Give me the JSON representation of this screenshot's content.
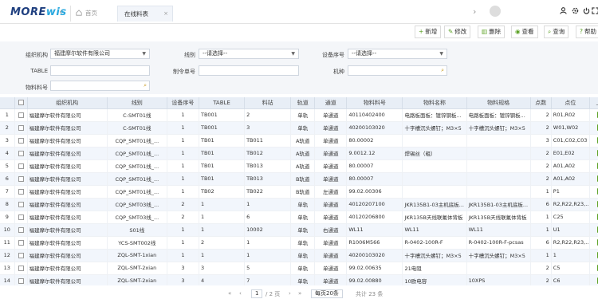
{
  "brand": {
    "logo_left": "MORE",
    "logo_right": "wis"
  },
  "tabs": {
    "home": "首页",
    "active": "在线料表",
    "close": "×"
  },
  "nav": {
    "back": "‹",
    "forward": "›"
  },
  "toolbar": {
    "add": "新增",
    "edit": "修改",
    "delete": "删除",
    "view": "查看",
    "query": "查询",
    "help": "帮助"
  },
  "filters": {
    "org_label": "组织机构",
    "org_value": "福建摩尔软件有限公司",
    "line_label": "线别",
    "line_value": "--请选择--",
    "device_label": "设备序号",
    "device_value": "--请选择--",
    "table_label": "TABLE",
    "table_value": "",
    "order_label": "制令单号",
    "order_value": "",
    "model_label": "机种",
    "model_value": "",
    "material_label": "物料料号",
    "material_value": ""
  },
  "columns": [
    "",
    "组织机构",
    "线别",
    "设备序号",
    "TABLE",
    "料站",
    "轨道",
    "通道",
    "物料料号",
    "物料名称",
    "物料规格",
    "点数",
    "点位",
    "上料"
  ],
  "rows": [
    [
      "1",
      "福建摩尔软件有限公司",
      "C-SMT01线",
      "1",
      "TB001",
      "2",
      "单轨",
      "单通道",
      "40110402400",
      "电路板面板：镀锌钢板...",
      "电路板面板：镀锌钢板...",
      "2",
      "R01,R02"
    ],
    [
      "2",
      "福建摩尔软件有限公司",
      "C-SMT01线",
      "1",
      "TB001",
      "3",
      "单轨",
      "单通道",
      "40200103020",
      "十字槽沉头螺钉；M3×5",
      "十字槽沉头螺钉；M3×5",
      "2",
      "W01,W02"
    ],
    [
      "3",
      "福建摩尔软件有限公司",
      "CQP_SMT01线_...",
      "1",
      "TB01",
      "TB011",
      "A轨道",
      "单通道",
      "80.00002",
      "",
      "",
      "3",
      "C01,C02,C03"
    ],
    [
      "4",
      "福建摩尔软件有限公司",
      "CQP_SMT01线_...",
      "1",
      "TB01",
      "TB012",
      "A轨道",
      "单通道",
      "9.0012.12",
      "焊锡丝（粗）",
      "",
      "2",
      "E01,E02"
    ],
    [
      "5",
      "福建摩尔软件有限公司",
      "CQP_SMT01线_...",
      "1",
      "TB01",
      "TB013",
      "A轨道",
      "单通道",
      "80.00007",
      "",
      "",
      "2",
      "A01,A02"
    ],
    [
      "6",
      "福建摩尔软件有限公司",
      "CQP_SMT01线_...",
      "1",
      "TB01",
      "TB013",
      "B轨道",
      "单通道",
      "80.00007",
      "",
      "",
      "2",
      "A01,A02"
    ],
    [
      "7",
      "福建摩尔软件有限公司",
      "CQP_SMT01线_...",
      "1",
      "TB02",
      "TB022",
      "B轨道",
      "左通道",
      "99.02.00306",
      "",
      "",
      "1",
      "P1"
    ],
    [
      "8",
      "福建摩尔软件有限公司",
      "CQP_SMT03线_...",
      "2",
      "1",
      "1",
      "单轨",
      "单通道",
      "40120207100",
      "JKR135B1-03主机底板...",
      "JKR135B1-03主机底板...",
      "6",
      "R2,R22,R23,..."
    ],
    [
      "9",
      "福建摩尔软件有限公司",
      "CQP_SMT03线_...",
      "2",
      "1",
      "6",
      "单轨",
      "单通道",
      "40120206800",
      "JKR135B天线联氟体背板",
      "JKR135B天线联氟体背板",
      "1",
      "C25"
    ],
    [
      "10",
      "福建摩尔软件有限公司",
      "S01线",
      "1",
      "1",
      "10002",
      "单轨",
      "右通道",
      "WL11",
      "WL11",
      "WL11",
      "1",
      "U1"
    ],
    [
      "11",
      "福建摩尔软件有限公司",
      "YCS-SMT002线",
      "1",
      "2",
      "1",
      "单轨",
      "单通道",
      "R1006M566",
      "R-0402-100R-F",
      "R-0402-100R-F-pcsas",
      "6",
      "R2,R22,R23,..."
    ],
    [
      "12",
      "福建摩尔软件有限公司",
      "ZQL-SMT-1xian",
      "1",
      "1",
      "1",
      "单轨",
      "单通道",
      "40200103020",
      "十字槽沉头螺钉；M3×5",
      "十字槽沉头螺钉；M3×5",
      "1",
      "1"
    ],
    [
      "13",
      "福建摩尔软件有限公司",
      "ZQL-SMT-2xian",
      "3",
      "3",
      "5",
      "单轨",
      "单通道",
      "99.02.00635",
      "21电阻",
      "",
      "2",
      "C5"
    ],
    [
      "14",
      "福建摩尔软件有限公司",
      "ZQL-SMT-2xian",
      "3",
      "4",
      "7",
      "单轨",
      "单通道",
      "99.02.00880",
      "10欧电容",
      "10XPS",
      "2",
      "C6"
    ]
  ],
  "pager": {
    "first": "«",
    "prev": "‹",
    "page": "1",
    "of": "/ 2 页",
    "next": "›",
    "last": "»",
    "per_page": "每页20条",
    "total": "共计 23 条"
  },
  "colors": {
    "accent": "#5aa022",
    "header_bg": "#e8eef6",
    "brand": "#1f3f7f"
  }
}
